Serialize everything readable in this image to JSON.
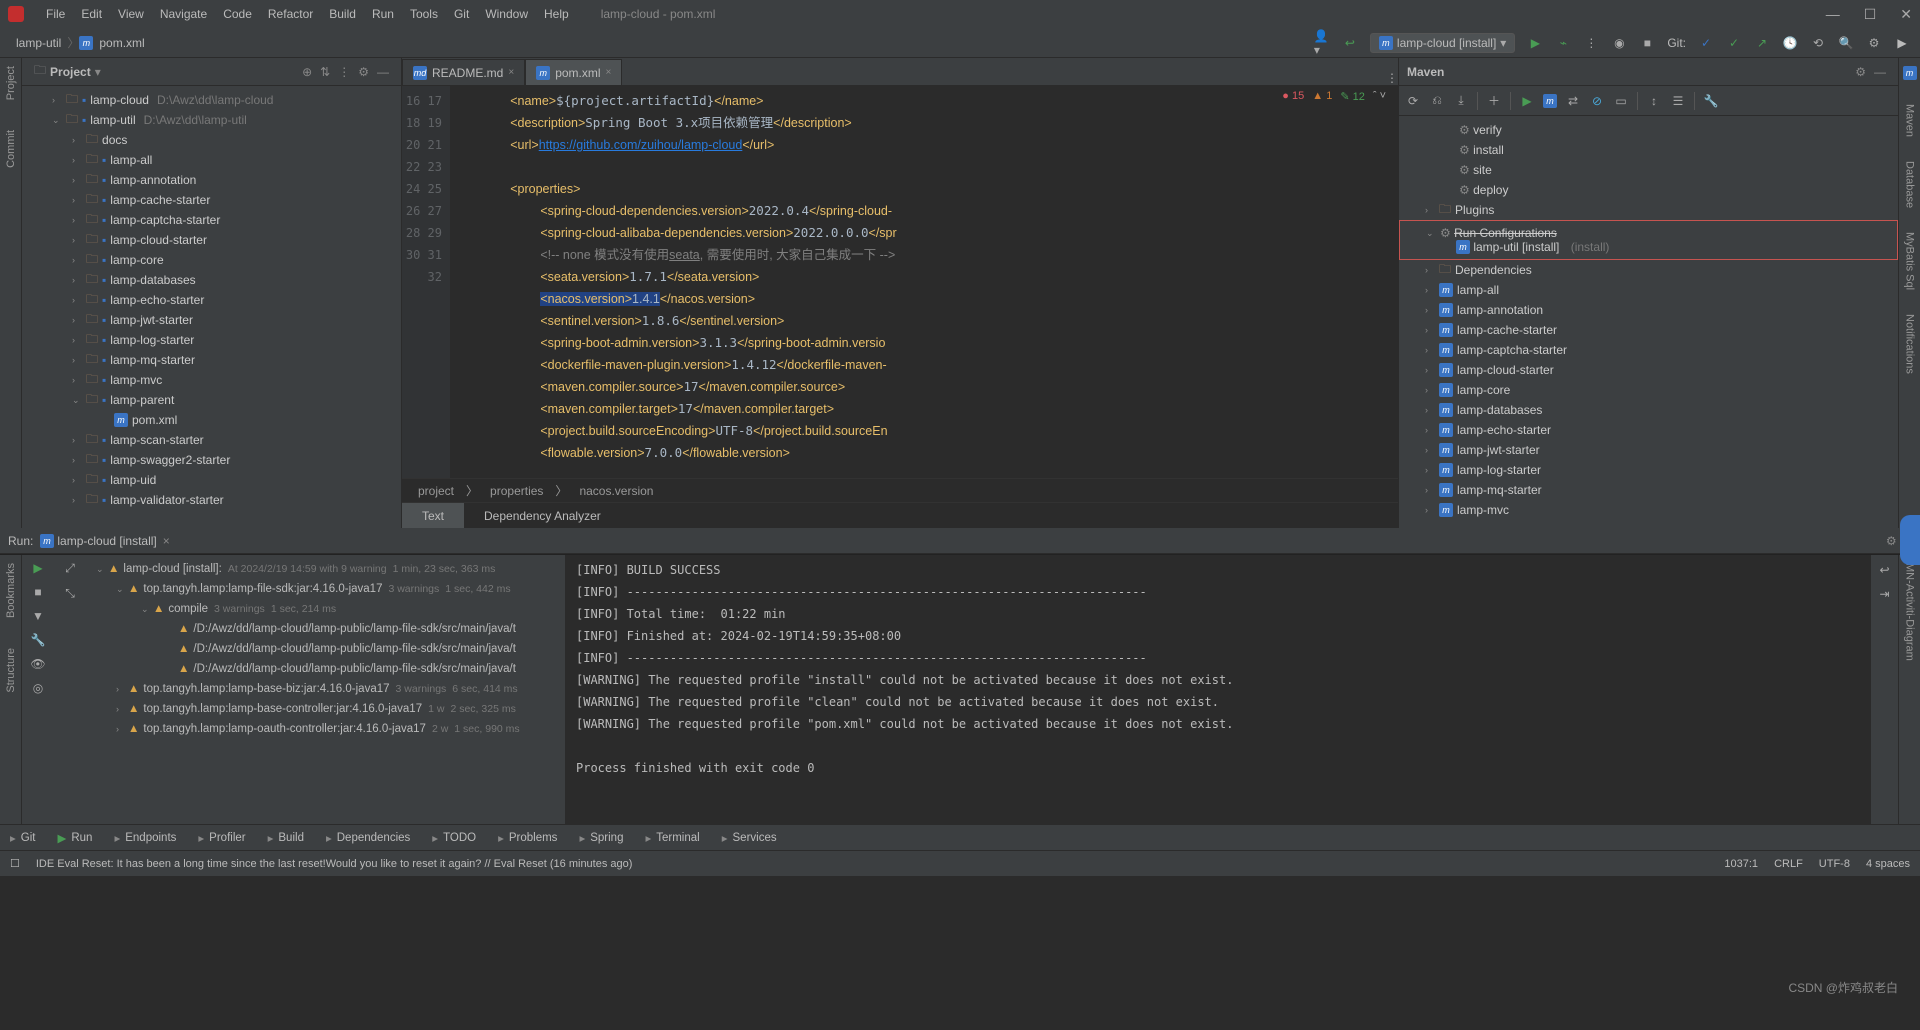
{
  "menus": [
    "File",
    "Edit",
    "View",
    "Navigate",
    "Code",
    "Refactor",
    "Build",
    "Run",
    "Tools",
    "Git",
    "Window",
    "Help"
  ],
  "window_title": "lamp-cloud - pom.xml",
  "nav": {
    "crumb1": "lamp-util",
    "crumb2": "pom.xml"
  },
  "run_config_name": "lamp-cloud [install]",
  "git_label": "Git:",
  "project": {
    "header": "Project",
    "rows": [
      {
        "indent": 30,
        "arrow": "›",
        "type": "mod",
        "name": "lamp-cloud",
        "hint": "D:\\Awz\\dd\\lamp-cloud"
      },
      {
        "indent": 30,
        "arrow": "⌄",
        "type": "mod",
        "name": "lamp-util",
        "hint": "D:\\Awz\\dd\\lamp-util"
      },
      {
        "indent": 50,
        "arrow": "›",
        "type": "fold",
        "name": "docs"
      },
      {
        "indent": 50,
        "arrow": "›",
        "type": "mod",
        "name": "lamp-all"
      },
      {
        "indent": 50,
        "arrow": "›",
        "type": "mod",
        "name": "lamp-annotation"
      },
      {
        "indent": 50,
        "arrow": "›",
        "type": "mod",
        "name": "lamp-cache-starter"
      },
      {
        "indent": 50,
        "arrow": "›",
        "type": "mod",
        "name": "lamp-captcha-starter"
      },
      {
        "indent": 50,
        "arrow": "›",
        "type": "mod",
        "name": "lamp-cloud-starter"
      },
      {
        "indent": 50,
        "arrow": "›",
        "type": "mod",
        "name": "lamp-core"
      },
      {
        "indent": 50,
        "arrow": "›",
        "type": "mod",
        "name": "lamp-databases"
      },
      {
        "indent": 50,
        "arrow": "›",
        "type": "mod",
        "name": "lamp-echo-starter"
      },
      {
        "indent": 50,
        "arrow": "›",
        "type": "mod",
        "name": "lamp-jwt-starter"
      },
      {
        "indent": 50,
        "arrow": "›",
        "type": "mod",
        "name": "lamp-log-starter"
      },
      {
        "indent": 50,
        "arrow": "›",
        "type": "mod",
        "name": "lamp-mq-starter"
      },
      {
        "indent": 50,
        "arrow": "›",
        "type": "mod",
        "name": "lamp-mvc"
      },
      {
        "indent": 50,
        "arrow": "⌄",
        "type": "mod",
        "name": "lamp-parent"
      },
      {
        "indent": 78,
        "arrow": " ",
        "type": "mfile",
        "name": "pom.xml"
      },
      {
        "indent": 50,
        "arrow": "›",
        "type": "mod",
        "name": "lamp-scan-starter"
      },
      {
        "indent": 50,
        "arrow": "›",
        "type": "mod",
        "name": "lamp-swagger2-starter"
      },
      {
        "indent": 50,
        "arrow": "›",
        "type": "mod",
        "name": "lamp-uid"
      },
      {
        "indent": 50,
        "arrow": "›",
        "type": "mod",
        "name": "lamp-validator-starter"
      }
    ]
  },
  "tabs": [
    {
      "name": "README.md",
      "active": false,
      "icon": "md"
    },
    {
      "name": "pom.xml",
      "active": true,
      "icon": "m"
    }
  ],
  "line_start": 16,
  "code_status": {
    "errors": "15",
    "warnings": "1",
    "typos": "12"
  },
  "breadcrumb": [
    "project",
    "properties",
    "nacos.version"
  ],
  "sub_tabs": [
    "Text",
    "Dependency Analyzer"
  ],
  "maven": {
    "header": "Maven",
    "lifecycle": [
      "verify",
      "install",
      "site",
      "deploy"
    ],
    "plugins": "Plugins",
    "runconf": "Run Configurations",
    "runconf_item": "lamp-util [install]",
    "runconf_hint": "(install)",
    "deps": "Dependencies",
    "modules": [
      "lamp-all",
      "lamp-annotation",
      "lamp-cache-starter",
      "lamp-captcha-starter",
      "lamp-cloud-starter",
      "lamp-core",
      "lamp-databases",
      "lamp-echo-starter",
      "lamp-jwt-starter",
      "lamp-log-starter",
      "lamp-mq-starter",
      "lamp-mvc"
    ]
  },
  "run": {
    "label": "Run:",
    "tab": "lamp-cloud [install]",
    "tree": [
      {
        "indent": 10,
        "arrow": "⌄",
        "icon": "warn",
        "txt": "lamp-cloud [install]:",
        "meta": "At 2024/2/19 14:59 with 9 warning",
        "time": "1 min, 23 sec, 363 ms"
      },
      {
        "indent": 30,
        "arrow": "⌄",
        "icon": "warn",
        "txt": "top.tangyh.lamp:lamp-file-sdk:jar:4.16.0-java17",
        "meta": "3 warnings",
        "time": "1 sec, 442 ms"
      },
      {
        "indent": 55,
        "arrow": "⌄",
        "icon": "warn",
        "txt": "compile",
        "meta": "3 warnings",
        "time": "1 sec, 214 ms"
      },
      {
        "indent": 80,
        "arrow": " ",
        "icon": "warn",
        "txt": "/D:/Awz/dd/lamp-cloud/lamp-public/lamp-file-sdk/src/main/java/t"
      },
      {
        "indent": 80,
        "arrow": " ",
        "icon": "warn",
        "txt": "/D:/Awz/dd/lamp-cloud/lamp-public/lamp-file-sdk/src/main/java/t"
      },
      {
        "indent": 80,
        "arrow": " ",
        "icon": "warn",
        "txt": "/D:/Awz/dd/lamp-cloud/lamp-public/lamp-file-sdk/src/main/java/t"
      },
      {
        "indent": 30,
        "arrow": "›",
        "icon": "warn",
        "txt": "top.tangyh.lamp:lamp-base-biz:jar:4.16.0-java17",
        "meta": "3 warnings",
        "time": "6 sec, 414 ms"
      },
      {
        "indent": 30,
        "arrow": "›",
        "icon": "warn",
        "txt": "top.tangyh.lamp:lamp-base-controller:jar:4.16.0-java17",
        "meta": "1 w",
        "time": "2 sec, 325 ms"
      },
      {
        "indent": 30,
        "arrow": "›",
        "icon": "warn",
        "txt": "top.tangyh.lamp:lamp-oauth-controller:jar:4.16.0-java17",
        "meta": "2 w",
        "time": "1 sec, 990 ms"
      }
    ],
    "console": [
      "[INFO] BUILD SUCCESS",
      "[INFO] ------------------------------------------------------------------------",
      "[INFO] Total time:  01:22 min",
      "[INFO] Finished at: 2024-02-19T14:59:35+08:00",
      "[INFO] ------------------------------------------------------------------------",
      "[WARNING] The requested profile \"install\" could not be activated because it does not exist.",
      "[WARNING] The requested profile \"clean\" could not be activated because it does not exist.",
      "[WARNING] The requested profile \"pom.xml\" could not be activated because it does not exist.",
      "",
      "Process finished with exit code 0"
    ]
  },
  "left_tools": [
    "Project",
    "Commit",
    "Bookmarks",
    "Structure"
  ],
  "right_tools": [
    "Maven",
    "Database",
    "MyBatis Sql",
    "Notifications",
    "MN-Activiti-Diagram"
  ],
  "bottom_tabs": [
    "Git",
    "Run",
    "Endpoints",
    "Profiler",
    "Build",
    "Dependencies",
    "TODO",
    "Problems",
    "Spring",
    "Terminal",
    "Services"
  ],
  "status": {
    "msg": "IDE Eval Reset: It has been a long time since the last reset!Would you like to reset it again? // Eval Reset (16 minutes ago)",
    "pos": "1037:1",
    "lf": "CRLF",
    "enc": "UTF-8",
    "indent": "4 spaces"
  },
  "watermark": "CSDN @炸鸡叔老白"
}
